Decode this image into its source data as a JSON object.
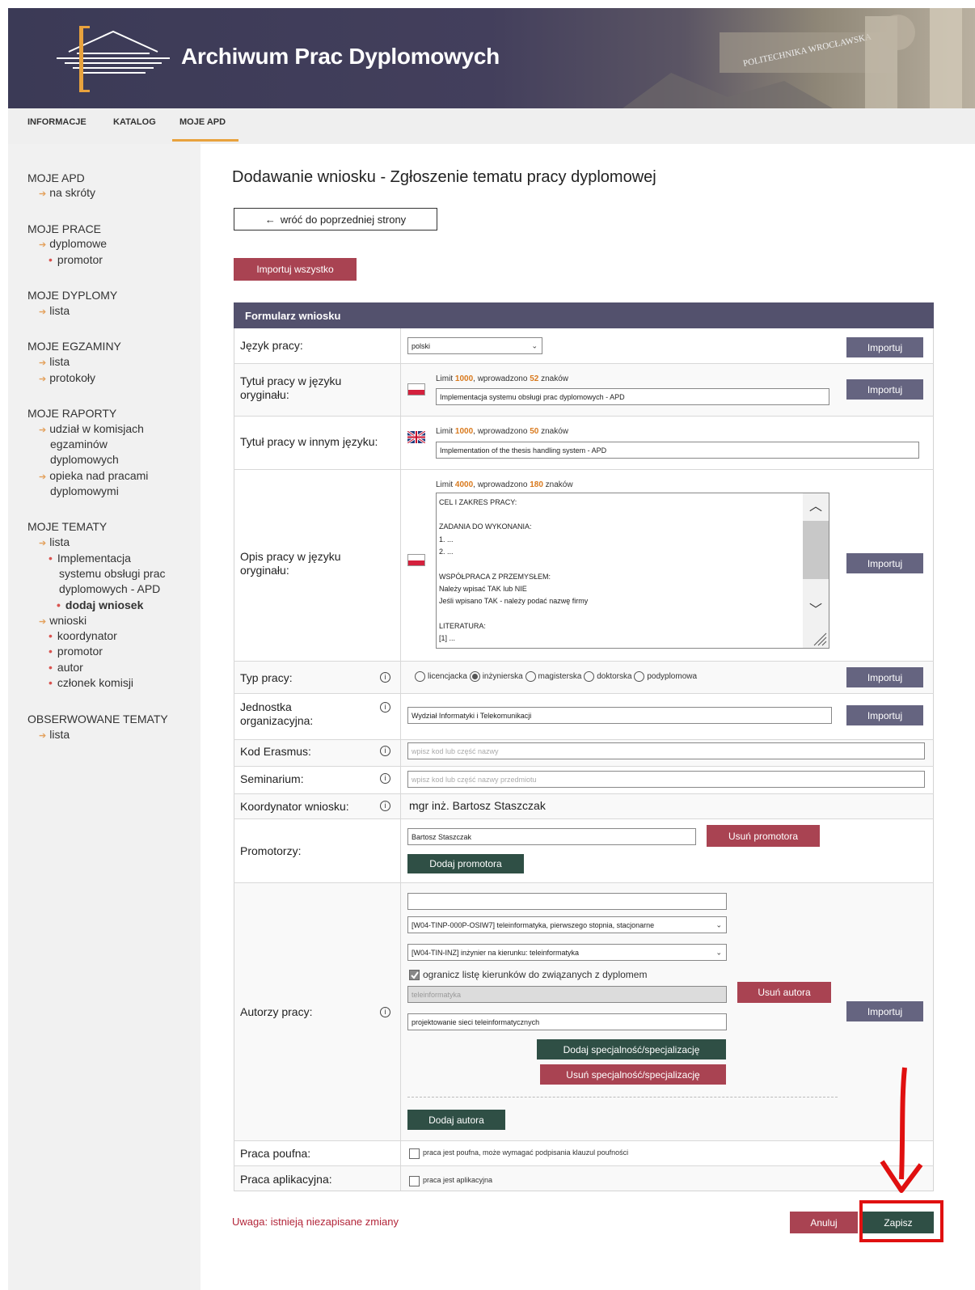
{
  "header": {
    "title": "Archiwum Prac Dyplomowych"
  },
  "topnav": {
    "items": [
      "INFORMACJE",
      "KATALOG",
      "MOJE APD"
    ],
    "active": "MOJE APD"
  },
  "sidebar": {
    "moje_apd": {
      "heading": "MOJE APD",
      "items": [
        "na skróty"
      ]
    },
    "moje_prace": {
      "heading": "MOJE PRACE",
      "items": [
        "dyplomowe"
      ],
      "sub": [
        "promotor"
      ]
    },
    "moje_dyplomy": {
      "heading": "MOJE DYPLOMY",
      "items": [
        "lista"
      ]
    },
    "moje_egzaminy": {
      "heading": "MOJE EGZAMINY",
      "items": [
        "lista",
        "protokoły"
      ]
    },
    "moje_raporty": {
      "heading": "MOJE RAPORTY",
      "items": [
        "udział w komisjach",
        "egzaminów",
        "dyplomowych",
        "opieka nad pracami",
        "dyplomowymi"
      ]
    },
    "moje_tematy": {
      "heading": "MOJE TEMATY",
      "lista": "lista",
      "topic_lines": [
        "Implementacja",
        "systemu obsługi prac",
        "dyplomowych - APD"
      ],
      "dodaj": "dodaj wniosek",
      "wnioski": "wnioski",
      "wnioski_sub": [
        "koordynator",
        "promotor",
        "autor",
        "członek komisji"
      ]
    },
    "obserwowane": {
      "heading": "OBSERWOWANE TEMATY",
      "items": [
        "lista"
      ]
    }
  },
  "page": {
    "title": "Dodawanie wniosku - Zgłoszenie tematu pracy dyplomowej",
    "back": "wróć do poprzedniej strony",
    "back_arrow": "←",
    "import_all": "Importuj wszystko",
    "form_title": "Formularz wniosku",
    "import": "Importuj",
    "warning": "Uwaga: istnieją niezapisane zmiany",
    "cancel": "Anuluj",
    "save": "Zapisz"
  },
  "form": {
    "lang": {
      "label": "Język pracy:",
      "value": "polski"
    },
    "title_orig": {
      "label": "Tytuł pracy w języku oryginału:",
      "limit_pre": "Limit",
      "limit": "1000",
      "mid": ", wprowadzono",
      "count": "52",
      "post": "znaków",
      "value": "Implementacja systemu obsługi prac dyplomowych - APD"
    },
    "title_other": {
      "label": "Tytuł pracy w innym języku:",
      "limit_pre": "Limit",
      "limit": "1000",
      "mid": ", wprowadzono",
      "count": "50",
      "post": "znaków",
      "value": "Implementation of the thesis handling system - APD"
    },
    "desc": {
      "label": "Opis pracy w języku oryginału:",
      "limit_pre": "Limit",
      "limit": "4000",
      "mid": ", wprowadzono",
      "count": "180",
      "post": "znaków",
      "lines": [
        "CEL I ZAKRES PRACY:",
        "",
        "ZADANIA DO WYKONANIA:",
        "1. ...",
        "2. ...",
        "",
        "WSPÓŁPRACA Z PRZEMYSŁEM:",
        "Należy wpisać TAK lub NIE",
        "Jeśli wpisano TAK - należy podać nazwę firmy",
        "",
        "LITERATURA:",
        "[1] ..."
      ]
    },
    "type": {
      "label": "Typ pracy:",
      "options": [
        "licencjacka",
        "inżynierska",
        "magisterska",
        "doktorska",
        "podyplomowa"
      ],
      "selected": "inżynierska"
    },
    "unit": {
      "label": "Jednostka organizacyjna:",
      "value": "Wydział Informatyki i Telekomunikacji"
    },
    "erasmus": {
      "label": "Kod Erasmus:",
      "placeholder": "wpisz kod lub część nazwy"
    },
    "seminar": {
      "label": "Seminarium:",
      "placeholder": "wpisz kod lub część nazwy przedmiotu"
    },
    "coordinator": {
      "label": "Koordynator wniosku:",
      "value": "mgr inż. Bartosz Staszczak"
    },
    "promoters": {
      "label": "Promotorzy:",
      "value": "Bartosz Staszczak",
      "remove": "Usuń promotora",
      "add": "Dodaj promotora"
    },
    "authors": {
      "label": "Autorzy pracy:",
      "program": "[W04-TINP-000P-OSIW7] teleinformatyka, pierwszego stopnia, stacjonarne",
      "degree": "[W04-TIN-INZ] inżynier na kierunku: teleinformatyka",
      "restrict": "ogranicz listę kierunków do związanych z dyplomem",
      "field": "teleinformatyka",
      "spec": "projektowanie sieci teleinformatycznych",
      "remove": "Usuń autora",
      "add_spec": "Dodaj specjalność/specjalizację",
      "remove_spec": "Usuń specjalność/specjalizację",
      "add": "Dodaj autora"
    },
    "confidential": {
      "label": "Praca poufna:",
      "text": "praca jest poufna, może wymagać podpisania klauzul poufności"
    },
    "applied": {
      "label": "Praca aplikacyjna:",
      "text": "praca jest aplikacyjna"
    }
  }
}
